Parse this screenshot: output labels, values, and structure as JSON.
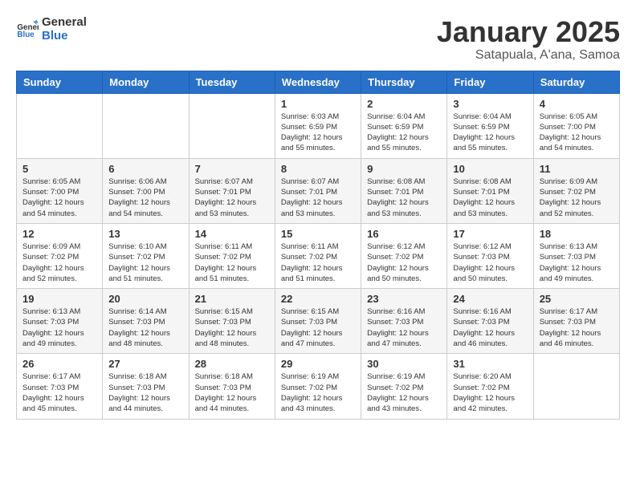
{
  "header": {
    "logo_general": "General",
    "logo_blue": "Blue",
    "month": "January 2025",
    "location": "Satapuala, A'ana, Samoa"
  },
  "weekdays": [
    "Sunday",
    "Monday",
    "Tuesday",
    "Wednesday",
    "Thursday",
    "Friday",
    "Saturday"
  ],
  "weeks": [
    [
      {
        "day": "",
        "info": ""
      },
      {
        "day": "",
        "info": ""
      },
      {
        "day": "",
        "info": ""
      },
      {
        "day": "1",
        "info": "Sunrise: 6:03 AM\nSunset: 6:59 PM\nDaylight: 12 hours\nand 55 minutes."
      },
      {
        "day": "2",
        "info": "Sunrise: 6:04 AM\nSunset: 6:59 PM\nDaylight: 12 hours\nand 55 minutes."
      },
      {
        "day": "3",
        "info": "Sunrise: 6:04 AM\nSunset: 6:59 PM\nDaylight: 12 hours\nand 55 minutes."
      },
      {
        "day": "4",
        "info": "Sunrise: 6:05 AM\nSunset: 7:00 PM\nDaylight: 12 hours\nand 54 minutes."
      }
    ],
    [
      {
        "day": "5",
        "info": "Sunrise: 6:05 AM\nSunset: 7:00 PM\nDaylight: 12 hours\nand 54 minutes."
      },
      {
        "day": "6",
        "info": "Sunrise: 6:06 AM\nSunset: 7:00 PM\nDaylight: 12 hours\nand 54 minutes."
      },
      {
        "day": "7",
        "info": "Sunrise: 6:07 AM\nSunset: 7:01 PM\nDaylight: 12 hours\nand 53 minutes."
      },
      {
        "day": "8",
        "info": "Sunrise: 6:07 AM\nSunset: 7:01 PM\nDaylight: 12 hours\nand 53 minutes."
      },
      {
        "day": "9",
        "info": "Sunrise: 6:08 AM\nSunset: 7:01 PM\nDaylight: 12 hours\nand 53 minutes."
      },
      {
        "day": "10",
        "info": "Sunrise: 6:08 AM\nSunset: 7:01 PM\nDaylight: 12 hours\nand 53 minutes."
      },
      {
        "day": "11",
        "info": "Sunrise: 6:09 AM\nSunset: 7:02 PM\nDaylight: 12 hours\nand 52 minutes."
      }
    ],
    [
      {
        "day": "12",
        "info": "Sunrise: 6:09 AM\nSunset: 7:02 PM\nDaylight: 12 hours\nand 52 minutes."
      },
      {
        "day": "13",
        "info": "Sunrise: 6:10 AM\nSunset: 7:02 PM\nDaylight: 12 hours\nand 51 minutes."
      },
      {
        "day": "14",
        "info": "Sunrise: 6:11 AM\nSunset: 7:02 PM\nDaylight: 12 hours\nand 51 minutes."
      },
      {
        "day": "15",
        "info": "Sunrise: 6:11 AM\nSunset: 7:02 PM\nDaylight: 12 hours\nand 51 minutes."
      },
      {
        "day": "16",
        "info": "Sunrise: 6:12 AM\nSunset: 7:02 PM\nDaylight: 12 hours\nand 50 minutes."
      },
      {
        "day": "17",
        "info": "Sunrise: 6:12 AM\nSunset: 7:03 PM\nDaylight: 12 hours\nand 50 minutes."
      },
      {
        "day": "18",
        "info": "Sunrise: 6:13 AM\nSunset: 7:03 PM\nDaylight: 12 hours\nand 49 minutes."
      }
    ],
    [
      {
        "day": "19",
        "info": "Sunrise: 6:13 AM\nSunset: 7:03 PM\nDaylight: 12 hours\nand 49 minutes."
      },
      {
        "day": "20",
        "info": "Sunrise: 6:14 AM\nSunset: 7:03 PM\nDaylight: 12 hours\nand 48 minutes."
      },
      {
        "day": "21",
        "info": "Sunrise: 6:15 AM\nSunset: 7:03 PM\nDaylight: 12 hours\nand 48 minutes."
      },
      {
        "day": "22",
        "info": "Sunrise: 6:15 AM\nSunset: 7:03 PM\nDaylight: 12 hours\nand 47 minutes."
      },
      {
        "day": "23",
        "info": "Sunrise: 6:16 AM\nSunset: 7:03 PM\nDaylight: 12 hours\nand 47 minutes."
      },
      {
        "day": "24",
        "info": "Sunrise: 6:16 AM\nSunset: 7:03 PM\nDaylight: 12 hours\nand 46 minutes."
      },
      {
        "day": "25",
        "info": "Sunrise: 6:17 AM\nSunset: 7:03 PM\nDaylight: 12 hours\nand 46 minutes."
      }
    ],
    [
      {
        "day": "26",
        "info": "Sunrise: 6:17 AM\nSunset: 7:03 PM\nDaylight: 12 hours\nand 45 minutes."
      },
      {
        "day": "27",
        "info": "Sunrise: 6:18 AM\nSunset: 7:03 PM\nDaylight: 12 hours\nand 44 minutes."
      },
      {
        "day": "28",
        "info": "Sunrise: 6:18 AM\nSunset: 7:03 PM\nDaylight: 12 hours\nand 44 minutes."
      },
      {
        "day": "29",
        "info": "Sunrise: 6:19 AM\nSunset: 7:02 PM\nDaylight: 12 hours\nand 43 minutes."
      },
      {
        "day": "30",
        "info": "Sunrise: 6:19 AM\nSunset: 7:02 PM\nDaylight: 12 hours\nand 43 minutes."
      },
      {
        "day": "31",
        "info": "Sunrise: 6:20 AM\nSunset: 7:02 PM\nDaylight: 12 hours\nand 42 minutes."
      },
      {
        "day": "",
        "info": ""
      }
    ]
  ]
}
